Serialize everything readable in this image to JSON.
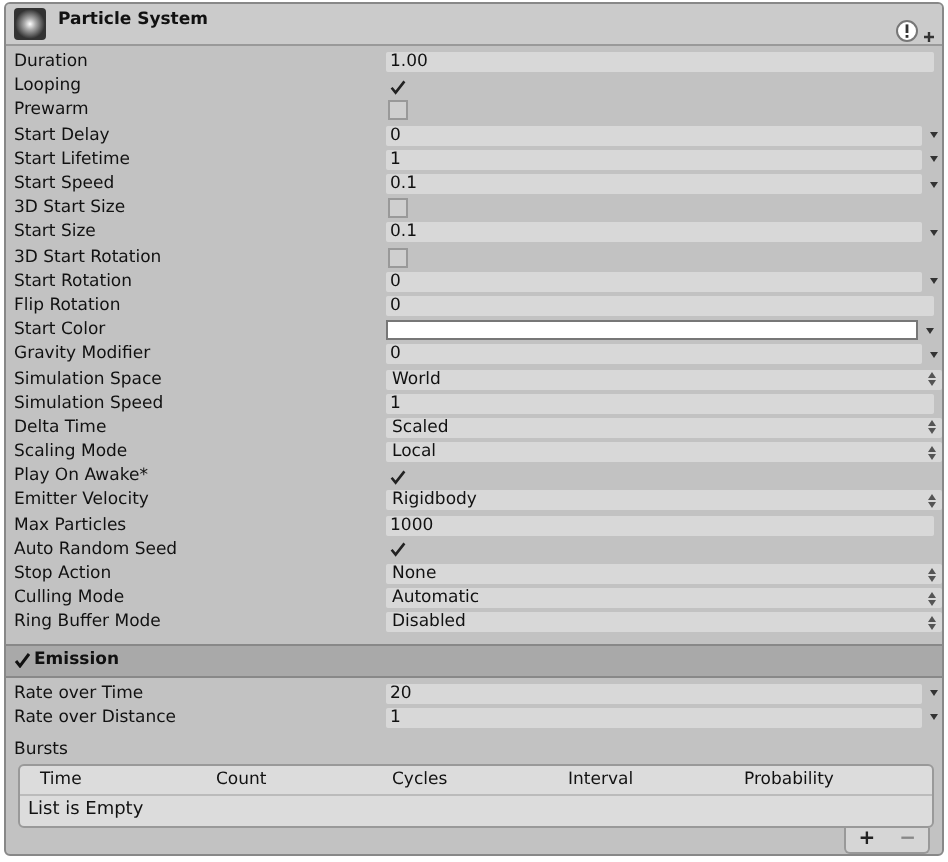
{
  "component": {
    "title": "Particle System"
  },
  "properties": [
    {
      "label": "Duration",
      "kind": "number",
      "value": "1.00"
    },
    {
      "label": "Looping",
      "kind": "checkbox",
      "checked": true
    },
    {
      "label": "Prewarm",
      "kind": "checkbox",
      "checked": false
    },
    {
      "label": "Start Delay",
      "kind": "curve",
      "value": "0"
    },
    {
      "label": "Start Lifetime",
      "kind": "curve",
      "value": "1"
    },
    {
      "label": "Start Speed",
      "kind": "curve",
      "value": "0.1"
    },
    {
      "label": "3D Start Size",
      "kind": "checkbox",
      "checked": false
    },
    {
      "label": "Start Size",
      "kind": "curve",
      "value": "0.1"
    },
    {
      "label": "3D Start Rotation",
      "kind": "checkbox",
      "checked": false
    },
    {
      "label": "Start Rotation",
      "kind": "curve",
      "value": "0"
    },
    {
      "label": "Flip Rotation",
      "kind": "number",
      "value": "0"
    },
    {
      "label": "Start Color",
      "kind": "color",
      "color": "#ffffff"
    },
    {
      "label": "Gravity Modifier",
      "kind": "curve",
      "value": "0"
    },
    {
      "label": "Simulation Space",
      "kind": "enum",
      "value": "World"
    },
    {
      "label": "Simulation Speed",
      "kind": "number",
      "value": "1"
    },
    {
      "label": "Delta Time",
      "kind": "enum",
      "value": "Scaled"
    },
    {
      "label": "Scaling Mode",
      "kind": "enum",
      "value": "Local"
    },
    {
      "label": "Play On Awake*",
      "kind": "checkbox",
      "checked": true
    },
    {
      "label": "Emitter Velocity",
      "kind": "enum",
      "value": "Rigidbody"
    },
    {
      "label": "Max Particles",
      "kind": "number",
      "value": "1000"
    },
    {
      "label": "Auto Random Seed",
      "kind": "checkbox",
      "checked": true
    },
    {
      "label": "Stop Action",
      "kind": "enum",
      "value": "None"
    },
    {
      "label": "Culling Mode",
      "kind": "enum",
      "value": "Automatic"
    },
    {
      "label": "Ring Buffer Mode",
      "kind": "enum",
      "value": "Disabled"
    }
  ],
  "emission": {
    "title": "Emission",
    "checked": true,
    "properties": [
      {
        "label": "Rate over Time",
        "kind": "curve",
        "value": "20"
      },
      {
        "label": "Rate over Distance",
        "kind": "curve",
        "value": "1"
      }
    ],
    "bursts": {
      "label": "Bursts",
      "columns": [
        "Time",
        "Count",
        "Cycles",
        "Interval",
        "Probability"
      ],
      "empty_text": "List is Empty",
      "buttons": [
        "+",
        "−"
      ]
    }
  }
}
